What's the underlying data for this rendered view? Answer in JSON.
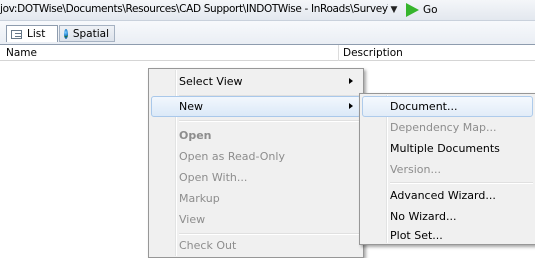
{
  "address_bar": {
    "path": "jov:DOTWise\\Documents\\Resources\\CAD Support\\INDOTWise - InRoads\\Survey\\Proje",
    "go_label": "Go"
  },
  "tabs": [
    {
      "label": "List",
      "icon": "list-icon",
      "active": true
    },
    {
      "label": "Spatial",
      "icon": "globe-icon",
      "active": false
    }
  ],
  "columns": {
    "name": "Name",
    "description": "Description"
  },
  "context_menu": {
    "items": [
      {
        "label": "Select View",
        "enabled": true,
        "submenu": true
      },
      {
        "label": "New",
        "enabled": true,
        "submenu": true,
        "highlighted": true
      },
      {
        "label": "Open",
        "enabled": false,
        "bold": true
      },
      {
        "label": "Open as Read-Only",
        "enabled": false
      },
      {
        "label": "Open With...",
        "enabled": false
      },
      {
        "label": "Markup",
        "enabled": false
      },
      {
        "label": "View",
        "enabled": false
      },
      {
        "label": "Check Out",
        "enabled": false
      }
    ]
  },
  "new_submenu": {
    "items": [
      {
        "label": "Document...",
        "enabled": true,
        "highlighted": true
      },
      {
        "label": "Dependency Map...",
        "enabled": false
      },
      {
        "label": "Multiple Documents",
        "enabled": true
      },
      {
        "label": "Version...",
        "enabled": false
      },
      {
        "label": "Advanced Wizard...",
        "enabled": true
      },
      {
        "label": "No Wizard...",
        "enabled": true
      },
      {
        "label": "Plot Set...",
        "enabled": true
      }
    ]
  },
  "colors": {
    "go_arrow": "#36b52c",
    "disabled_text": "#8d8d8d",
    "highlight_border": "#a9c8ea"
  }
}
